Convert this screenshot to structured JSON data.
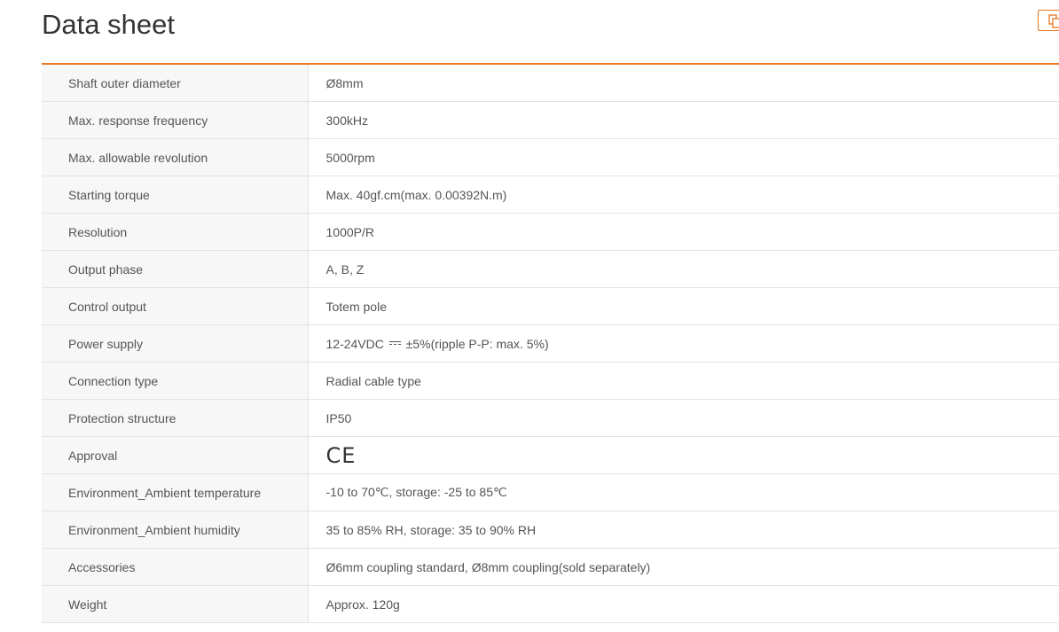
{
  "page": {
    "title": "Data sheet"
  },
  "rows": [
    {
      "label": "Shaft outer diameter",
      "value": "Ø8mm"
    },
    {
      "label": "Max. response frequency",
      "value": "300kHz"
    },
    {
      "label": "Max. allowable revolution",
      "value": "5000rpm"
    },
    {
      "label": "Starting torque",
      "value": "Max. 40gf.cm(max. 0.00392N.m)"
    },
    {
      "label": "Resolution",
      "value": "1000P/R"
    },
    {
      "label": "Output phase",
      "value": "A, B, Z"
    },
    {
      "label": "Control output",
      "value": "Totem pole"
    },
    {
      "label": "Power supply",
      "value_pre": "12-24VDC",
      "value_post": "±5%(ripple P-P: max. 5%)"
    },
    {
      "label": "Connection type",
      "value": "Radial cable type"
    },
    {
      "label": "Protection structure",
      "value": "IP50"
    },
    {
      "label": "Approval",
      "value": "CE"
    },
    {
      "label": "Environment_Ambient temperature",
      "value": "-10 to 70℃, storage: -25 to 85℃"
    },
    {
      "label": "Environment_Ambient humidity",
      "value": "35 to 85% RH, storage: 35 to 90% RH"
    },
    {
      "label": "Accessories",
      "value": "Ø6mm coupling standard, Ø8mm coupling(sold separately)"
    },
    {
      "label": "Weight",
      "value": "Approx. 120g"
    }
  ],
  "colors": {
    "accent": "#e87722",
    "label_bg": "#f7f7f7",
    "border": "#e3e3e3"
  },
  "icons": {
    "copy": "copy-icon",
    "dc": "dc-current-icon"
  }
}
